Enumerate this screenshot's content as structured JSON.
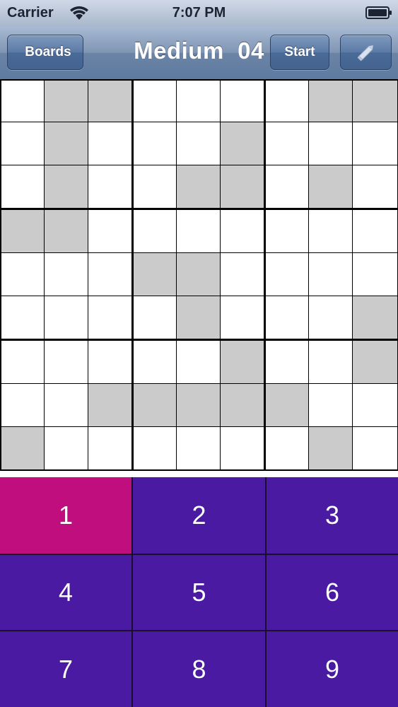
{
  "status_bar": {
    "carrier": "Carrier",
    "time": "7:07 PM",
    "wifi_icon": "wifi-icon",
    "battery_icon": "battery-icon"
  },
  "nav": {
    "back_label": "Boards",
    "title": "Medium  04",
    "start_label": "Start",
    "edit_icon": "pencil-icon"
  },
  "board": {
    "shaded": [
      [
        0,
        1,
        1,
        0,
        0,
        0,
        0,
        1,
        1
      ],
      [
        0,
        1,
        0,
        0,
        0,
        1,
        0,
        0,
        0
      ],
      [
        0,
        1,
        0,
        0,
        1,
        1,
        0,
        1,
        0
      ],
      [
        1,
        1,
        0,
        0,
        0,
        0,
        0,
        0,
        0
      ],
      [
        0,
        0,
        0,
        1,
        1,
        0,
        0,
        0,
        0
      ],
      [
        0,
        0,
        0,
        0,
        1,
        0,
        0,
        0,
        1
      ],
      [
        0,
        0,
        0,
        0,
        0,
        1,
        0,
        0,
        1
      ],
      [
        0,
        0,
        1,
        1,
        1,
        1,
        1,
        0,
        0
      ],
      [
        1,
        0,
        0,
        0,
        0,
        0,
        0,
        1,
        0
      ]
    ],
    "colors": {
      "shaded": "#cbcbcb",
      "empty": "#ffffff",
      "lines": "#000000"
    }
  },
  "keypad": {
    "keys": [
      "1",
      "2",
      "3",
      "4",
      "5",
      "6",
      "7",
      "8",
      "9"
    ],
    "selected": "1",
    "colors": {
      "key": "#4a1aa3",
      "selected": "#c10e7e",
      "text": "#ffffff"
    }
  }
}
